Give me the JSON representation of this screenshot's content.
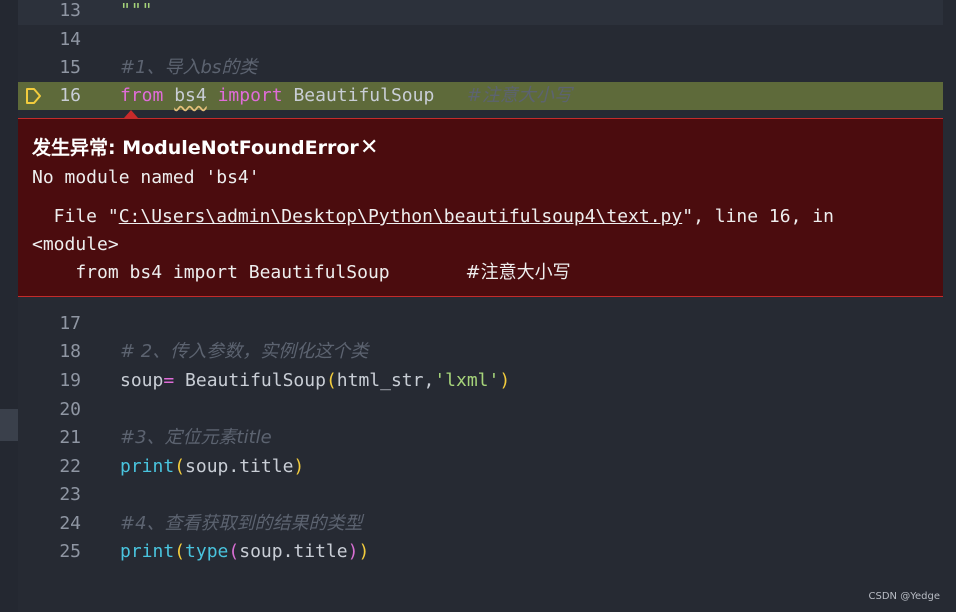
{
  "lines": [
    {
      "number": "13",
      "text": "\"\"\""
    },
    {
      "number": "14"
    },
    {
      "number": "15",
      "comment": "#1、导入bs的类"
    },
    {
      "number": "16",
      "kw_from": "from",
      "module": "bs4",
      "kw_import": "import",
      "name": "BeautifulSoup",
      "comment": "#注意大小写"
    },
    {
      "number": "17"
    },
    {
      "number": "18",
      "comment": "# 2、传入参数，实例化这个类"
    },
    {
      "number": "19",
      "var": "soup",
      "op": "=",
      "call": "BeautifulSoup",
      "args": "html_str,",
      "str": "'lxml'"
    },
    {
      "number": "20"
    },
    {
      "number": "21",
      "comment": "#3、定位元素title"
    },
    {
      "number": "22",
      "fn": "print",
      "arg": "soup.title"
    },
    {
      "number": "23"
    },
    {
      "number": "24",
      "comment": "#4、查看获取到的结果的类型"
    },
    {
      "number": "25",
      "fn": "print",
      "fn2": "type",
      "arg": "soup.title"
    }
  ],
  "exception": {
    "title": "发生异常: ModuleNotFoundError",
    "close": "✕",
    "message": "No module named 'bs4'",
    "file_prefix": "  File \"",
    "file_path": "C:\\Users\\admin\\Desktop\\Python\\beautifulsoup4\\text.py",
    "file_suffix": "\", line 16, in",
    "module_line": "<module>",
    "source_code": "    from bs4 import BeautifulSoup       ",
    "source_comment": "#注意大小写"
  },
  "watermark": "CSDN @Yedge",
  "colors": {
    "background": "#262a33",
    "exception_bg": "#4b0c0e",
    "exception_border": "#c42b2b",
    "current_line": "#5e6a3a",
    "keyword": "#e06cd9",
    "function": "#49c4de",
    "string": "#a6d47a",
    "breakpoint": "#f2cc3d"
  }
}
